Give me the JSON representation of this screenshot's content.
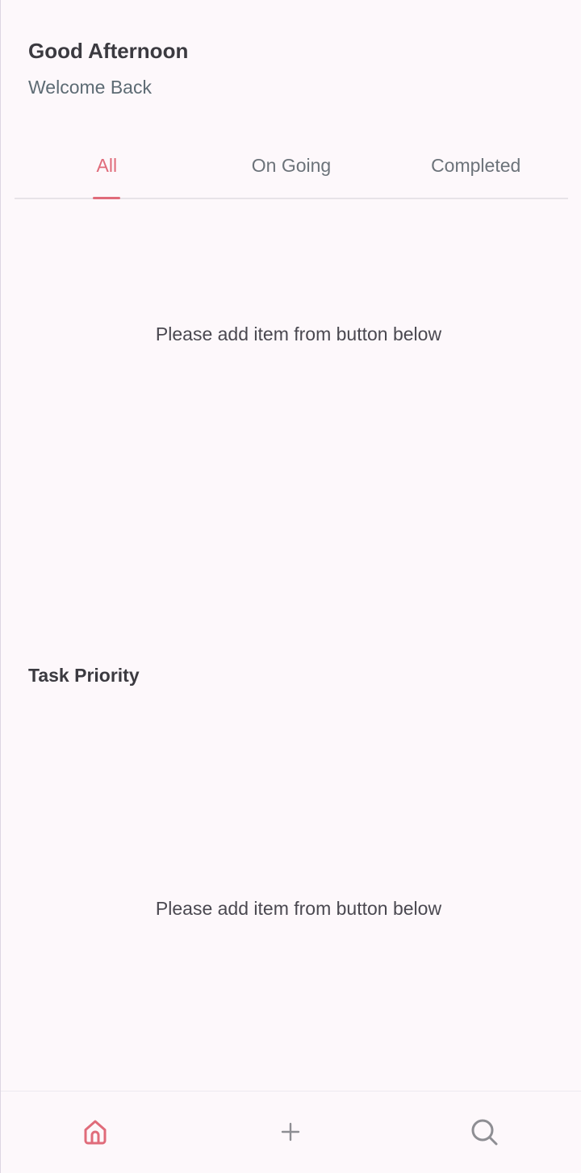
{
  "header": {
    "greeting": "Good Afternoon",
    "subtitle": "Welcome Back"
  },
  "tabs": [
    {
      "label": "All",
      "active": true
    },
    {
      "label": "On Going",
      "active": false
    },
    {
      "label": "Completed",
      "active": false
    }
  ],
  "task_list": {
    "empty_message": "Please add item from button below"
  },
  "task_priority": {
    "title": "Task Priority",
    "empty_message": "Please add item from button below"
  },
  "bottom_nav": [
    {
      "icon": "home-icon",
      "active": true
    },
    {
      "icon": "plus-icon",
      "active": false
    },
    {
      "icon": "search-icon",
      "active": false
    }
  ],
  "colors": {
    "accent": "#e06b7a",
    "background": "#fdf8fb",
    "inactive": "#6c737a"
  }
}
